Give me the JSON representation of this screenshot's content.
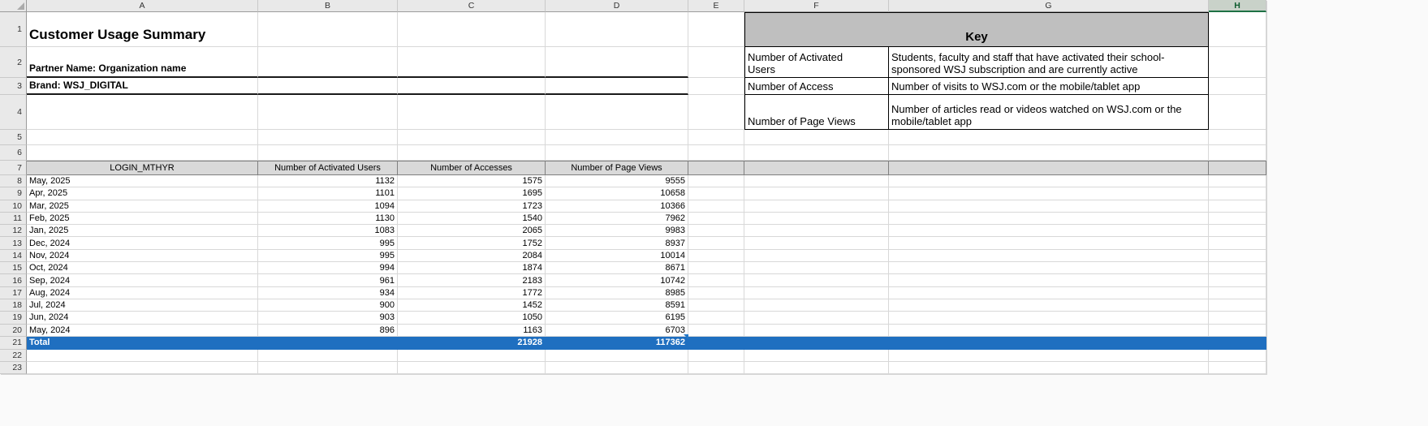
{
  "sheet": {
    "columns": [
      "A",
      "B",
      "C",
      "D",
      "E",
      "F",
      "G",
      "H"
    ],
    "row_numbers": [
      "1",
      "2",
      "3",
      "4",
      "5",
      "6",
      "7",
      "8",
      "9",
      "10",
      "11",
      "12",
      "13",
      "14",
      "15",
      "16",
      "17",
      "18",
      "19",
      "20",
      "21",
      "22",
      "23"
    ],
    "selected_column": "H"
  },
  "header": {
    "title": "Customer Usage Summary",
    "partner": "Partner Name: Organization name",
    "brand": "Brand: WSJ_DIGITAL"
  },
  "key": {
    "title": "Key",
    "entries": [
      {
        "term": "Number of Activated Users",
        "definition": "Students, faculty and staff that have activated their school-sponsored WSJ subscription and are currently active"
      },
      {
        "term": "Number of Access",
        "definition": "Number of visits to WSJ.com or the mobile/tablet app"
      },
      {
        "term": "Number of Page Views",
        "definition": "Number of articles read or videos watched on WSJ.com or the mobile/tablet app"
      }
    ]
  },
  "usage_table": {
    "headers": {
      "month": "LOGIN_MTHYR",
      "activated": "Number of Activated Users",
      "accesses": "Number of Accesses",
      "views": "Number of Page Views"
    },
    "rows": [
      {
        "month": "May, 2025",
        "activated": "1132",
        "accesses": "1575",
        "views": "9555"
      },
      {
        "month": "Apr, 2025",
        "activated": "1101",
        "accesses": "1695",
        "views": "10658"
      },
      {
        "month": "Mar, 2025",
        "activated": "1094",
        "accesses": "1723",
        "views": "10366"
      },
      {
        "month": "Feb, 2025",
        "activated": "1130",
        "accesses": "1540",
        "views": "7962"
      },
      {
        "month": "Jan, 2025",
        "activated": "1083",
        "accesses": "2065",
        "views": "9983"
      },
      {
        "month": "Dec, 2024",
        "activated": "995",
        "accesses": "1752",
        "views": "8937"
      },
      {
        "month": "Nov, 2024",
        "activated": "995",
        "accesses": "2084",
        "views": "10014"
      },
      {
        "month": "Oct, 2024",
        "activated": "994",
        "accesses": "1874",
        "views": "8671"
      },
      {
        "month": "Sep, 2024",
        "activated": "961",
        "accesses": "2183",
        "views": "10742"
      },
      {
        "month": "Aug, 2024",
        "activated": "934",
        "accesses": "1772",
        "views": "8985"
      },
      {
        "month": "Jul, 2024",
        "activated": "900",
        "accesses": "1452",
        "views": "8591"
      },
      {
        "month": "Jun, 2024",
        "activated": "903",
        "accesses": "1050",
        "views": "6195"
      },
      {
        "month": "May, 2024",
        "activated": "896",
        "accesses": "1163",
        "views": "6703"
      }
    ],
    "total": {
      "label": "Total",
      "activated": "",
      "accesses": "21928",
      "views": "117362"
    }
  },
  "colors": {
    "total_row_bg": "#1F6FC0",
    "total_row_text": "#FFFFFF",
    "key_header_bg": "#BFBFBF",
    "table_header_bg": "#D9D9D9",
    "selected_column_bg": "#C9D2C9",
    "selected_column_accent": "#1E7145",
    "flag": "#2478C8"
  }
}
